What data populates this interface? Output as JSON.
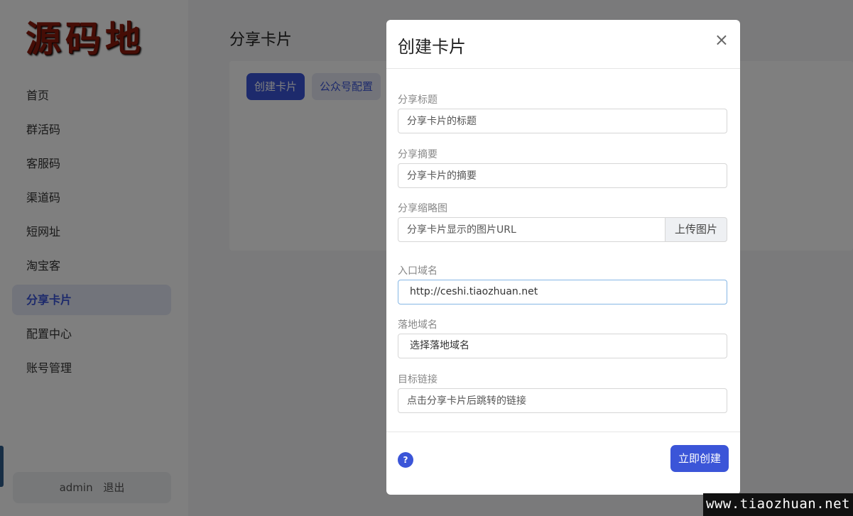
{
  "sidebar": {
    "logo_text": "源码地带",
    "items": [
      {
        "label": "首页"
      },
      {
        "label": "群活码"
      },
      {
        "label": "客服码"
      },
      {
        "label": "渠道码"
      },
      {
        "label": "短网址"
      },
      {
        "label": "淘宝客"
      },
      {
        "label": "分享卡片",
        "active": true
      },
      {
        "label": "配置中心"
      },
      {
        "label": "账号管理"
      }
    ],
    "user": {
      "name": "admin",
      "logout": "退出"
    }
  },
  "main": {
    "title": "分享卡片",
    "buttons": {
      "create": "创建卡片",
      "config": "公众号配置"
    }
  },
  "modal": {
    "title": "创建卡片",
    "close": "×",
    "fields": {
      "share_title": {
        "label": "分享标题",
        "placeholder": "分享卡片的标题"
      },
      "share_summary": {
        "label": "分享摘要",
        "placeholder": "分享卡片的摘要"
      },
      "share_thumb": {
        "label": "分享缩略图",
        "placeholder": "分享卡片显示的图片URL",
        "button": "上传图片"
      },
      "entry_domain": {
        "label": "入口域名",
        "value": "http://ceshi.tiaozhuan.net"
      },
      "landing_domain": {
        "label": "落地域名",
        "value": "选择落地域名"
      },
      "target_link": {
        "label": "目标链接",
        "placeholder": "点击分享卡片后跳转的链接"
      }
    },
    "footer": {
      "help": "?",
      "submit": "立即创建"
    }
  },
  "watermark": "www.tiaozhuan.net",
  "colors": {
    "accent": "#3b55d8",
    "overlay": "rgba(0,0,0,0.5)"
  }
}
